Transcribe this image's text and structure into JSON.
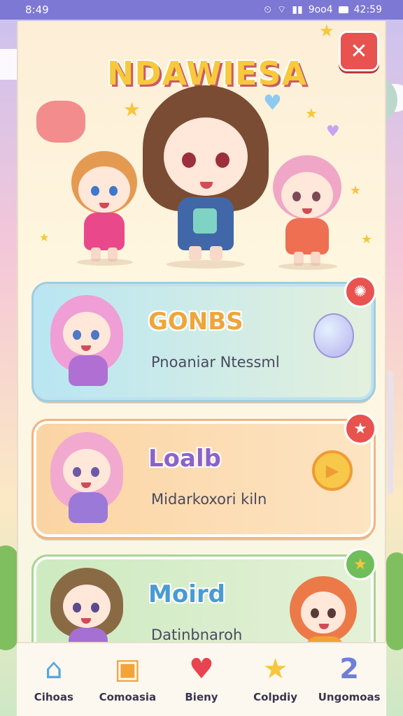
{
  "status_bar": {
    "time": "8:49",
    "right_text": "9oo4",
    "clock": "42:59"
  },
  "header": {
    "title": "NDAWIESA",
    "close_icon": "close-icon"
  },
  "cards": [
    {
      "title": "GONBS",
      "subtitle": "Pnoaniar Ntessml",
      "badge_icon": "badge-icon"
    },
    {
      "title": "Loalb",
      "subtitle": "Midarkoxori kiln",
      "badge_icon": "star-icon"
    },
    {
      "title": "Moird",
      "subtitle": "Datinbnaroh",
      "badge_icon": "star-icon"
    }
  ],
  "bottom_nav": {
    "items": [
      {
        "label": "Cihoas",
        "icon": "home-icon"
      },
      {
        "label": "Comoasia",
        "icon": "folder-icon"
      },
      {
        "label": "Bieny",
        "icon": "heart-icon"
      },
      {
        "label": "Colpdiy",
        "icon": "star-icon"
      },
      {
        "label": "Ungomoas",
        "icon": "number-two-icon"
      }
    ]
  },
  "colors": {
    "accent_red": "#e8524f",
    "status_bar": "#7d78d3",
    "star_yellow": "#f6c63d"
  }
}
